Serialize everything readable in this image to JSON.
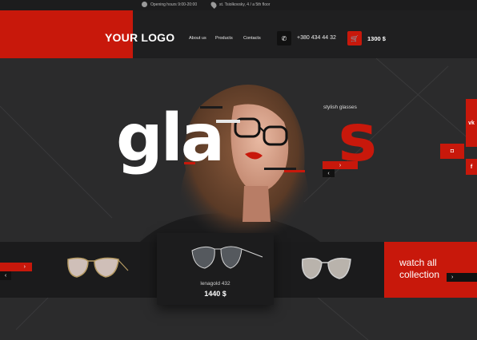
{
  "topbar": {
    "hours": "Opening hours 9:00-20:00",
    "address": "st. Tsiolkovsky, 4 / a 5th floor",
    "clock_icon": "clock-icon",
    "location_icon": "location-pin-icon"
  },
  "header": {
    "logo": "YOUR LOGO",
    "nav": [
      "About us",
      "Products",
      "Contacts"
    ],
    "phone": "+380 434 44 32",
    "phone_icon": "phone-icon",
    "cart_icon": "cart-icon",
    "cart_total": "1300 $"
  },
  "hero": {
    "title_white": "glasses",
    "title_red_fragment": "s",
    "subtitle": "stylish glasses",
    "next_arrow": "›",
    "prev_arrow": "‹"
  },
  "social": [
    {
      "icon": "vk-icon",
      "label": "vk"
    },
    {
      "icon": "instagram-icon",
      "label": "◘"
    },
    {
      "icon": "facebook-icon",
      "label": "f"
    }
  ],
  "products": {
    "next_arrow": "›",
    "prev_arrow": "‹",
    "featured": {
      "name": "lenagold 432",
      "price": "1440 $"
    },
    "watch_all": "watch all collection",
    "watch_arrow": "›"
  },
  "colors": {
    "accent": "#c8180b",
    "background": "#2b2b2c",
    "dark": "#1b1b1c"
  }
}
